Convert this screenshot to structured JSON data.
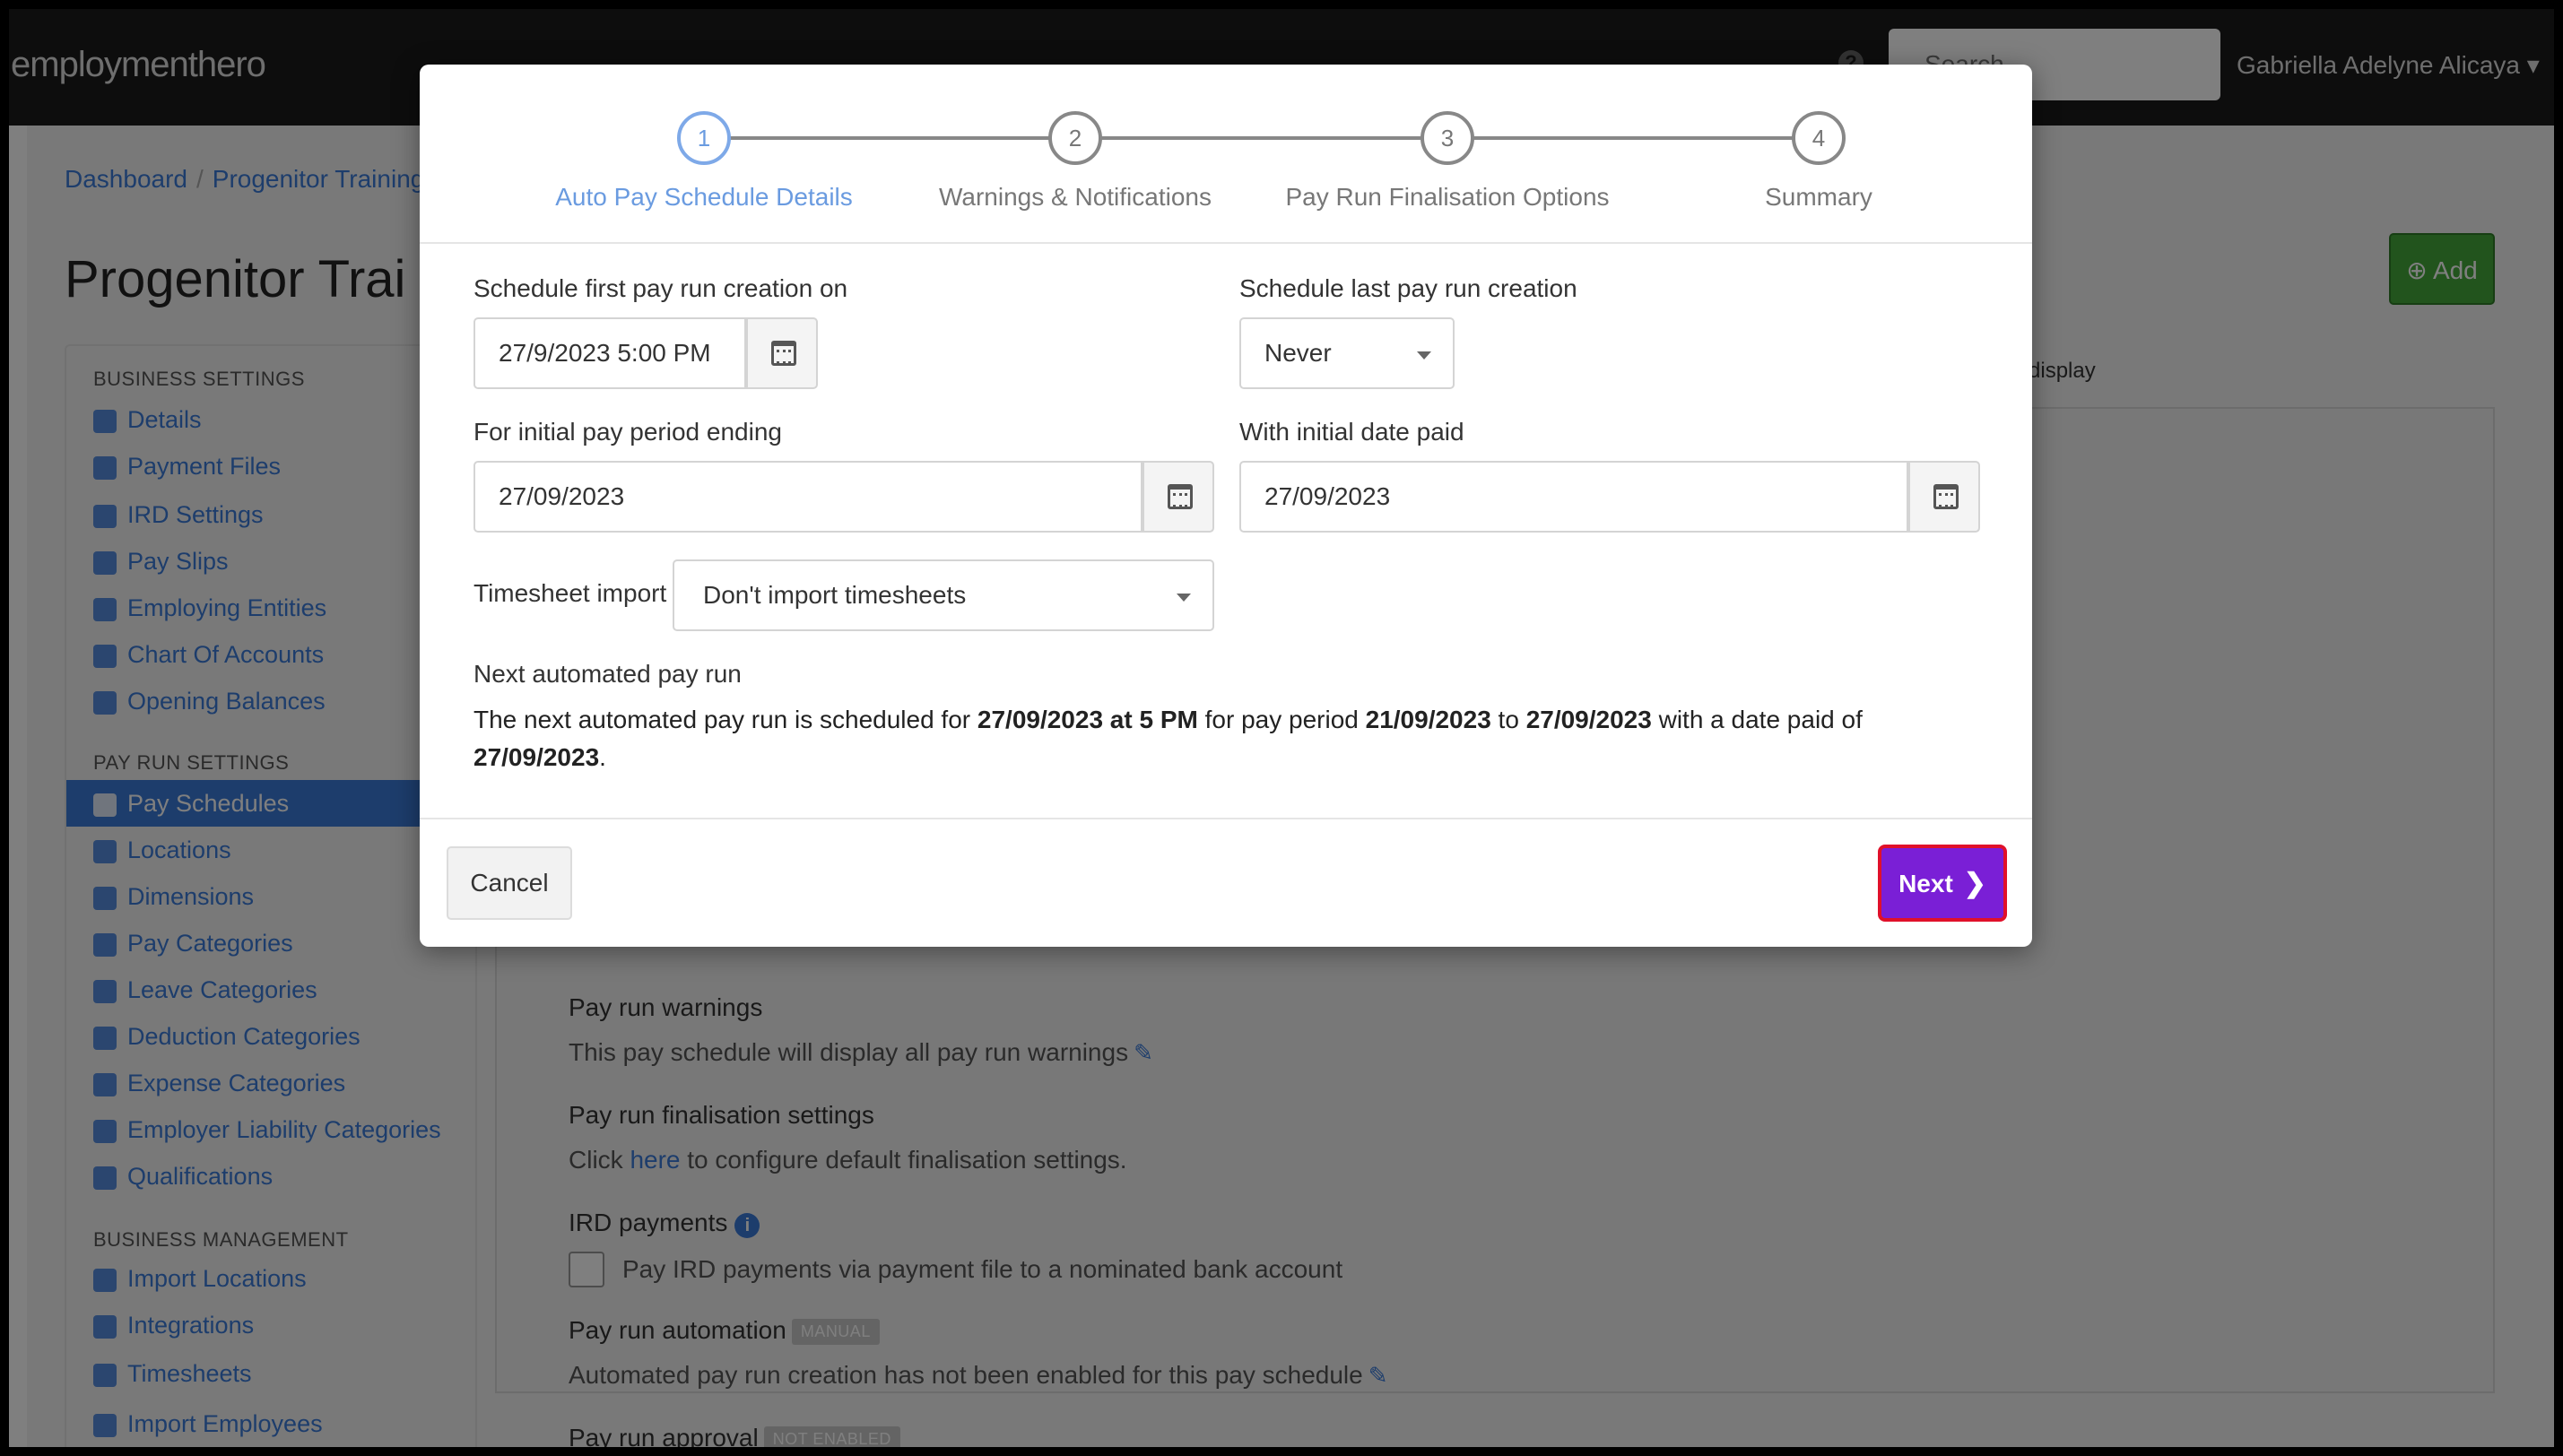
{
  "navbar": {
    "logo": "employmenthero",
    "search_placeholder": "Search",
    "help_glyph": "?",
    "user_name": "Gabriella Adelyne Alicaya ▾"
  },
  "breadcrumb": [
    "Dashboard",
    "Progenitor Training"
  ],
  "page_title": "Progenitor Trai",
  "sidebar": {
    "business_settings_heading": "BUSINESS SETTINGS",
    "business_settings": [
      {
        "label": "Details",
        "icon": "gear-icon"
      },
      {
        "label": "Payment Files",
        "icon": "file-icon"
      },
      {
        "label": "IRD Settings",
        "icon": "scale-icon"
      },
      {
        "label": "Pay Slips",
        "icon": "document-icon"
      },
      {
        "label": "Employing Entities",
        "icon": "bank-icon"
      },
      {
        "label": "Chart Of Accounts",
        "icon": "list-icon"
      },
      {
        "label": "Opening Balances",
        "icon": "balance-icon"
      }
    ],
    "pay_run_settings_heading": "PAY RUN SETTINGS",
    "pay_run_settings": [
      {
        "label": "Pay Schedules",
        "icon": "calendar-icon",
        "active": true
      },
      {
        "label": "Locations",
        "icon": "globe-icon"
      },
      {
        "label": "Dimensions",
        "icon": "chart-icon"
      },
      {
        "label": "Pay Categories",
        "icon": "money-icon"
      },
      {
        "label": "Leave Categories",
        "icon": "plane-icon"
      },
      {
        "label": "Deduction Categories",
        "icon": "minus-circle-icon"
      },
      {
        "label": "Expense Categories",
        "icon": "dollar-icon"
      },
      {
        "label": "Employer Liability Categories",
        "icon": "area-chart-icon"
      },
      {
        "label": "Qualifications",
        "icon": "check-icon"
      }
    ],
    "business_management_heading": "BUSINESS MANAGEMENT",
    "business_management": [
      {
        "label": "Import Locations",
        "icon": "pin-icon"
      },
      {
        "label": "Integrations",
        "icon": "puzzle-icon"
      },
      {
        "label": "Timesheets",
        "icon": "clock-icon"
      },
      {
        "label": "Import Employees",
        "icon": "people-icon"
      }
    ]
  },
  "background": {
    "add_label": "Add",
    "display_text": "o display",
    "pay_run_warnings_label": "Pay run warnings",
    "pay_run_warnings_text": "This pay schedule will display all pay run warnings",
    "finalisation_label": "Pay run finalisation settings",
    "finalisation_prefix": "Click",
    "finalisation_link": "here",
    "finalisation_suffix": "to configure default finalisation settings.",
    "ird_label": "IRD payments",
    "ird_checkbox_label": "Pay IRD payments via payment file to a nominated bank account",
    "automation_label": "Pay run automation",
    "automation_badge": "MANUAL",
    "automation_text": "Automated pay run creation has not been enabled for this pay schedule",
    "approval_label": "Pay run approval",
    "approval_badge": "NOT ENABLED"
  },
  "modal": {
    "steps": [
      {
        "number": "1",
        "label": "Auto Pay Schedule Details",
        "active": true
      },
      {
        "number": "2",
        "label": "Warnings & Notifications"
      },
      {
        "number": "3",
        "label": "Pay Run Finalisation Options"
      },
      {
        "number": "4",
        "label": "Summary"
      }
    ],
    "first_creation_label": "Schedule first pay run creation on",
    "first_creation_value": "27/9/2023 5:00 PM",
    "last_creation_label": "Schedule last pay run creation",
    "last_creation_value": "Never",
    "initial_period_label": "For initial pay period ending",
    "initial_period_value": "27/09/2023",
    "initial_paid_label": "With initial date paid",
    "initial_paid_value": "27/09/2023",
    "timesheet_label": "Timesheet import",
    "timesheet_value": "Don't import timesheets",
    "next_title": "Next automated pay run",
    "next_desc": {
      "p1": "The next automated pay run is scheduled for ",
      "b1": "27/09/2023 at 5 PM",
      "p2": " for pay period ",
      "b2": "21/09/2023",
      "p3": " to ",
      "b3": "27/09/2023",
      "p4": " with a date paid of ",
      "b4": "27/09/2023",
      "p5": "."
    },
    "cancel_label": "Cancel",
    "next_label": "Next",
    "next_chevron": "❯"
  },
  "colors": {
    "accent_blue": "#3a7ad9",
    "next_button": "#7a1fd6",
    "next_button_border": "#e0102a",
    "add_button": "#45a83a"
  }
}
